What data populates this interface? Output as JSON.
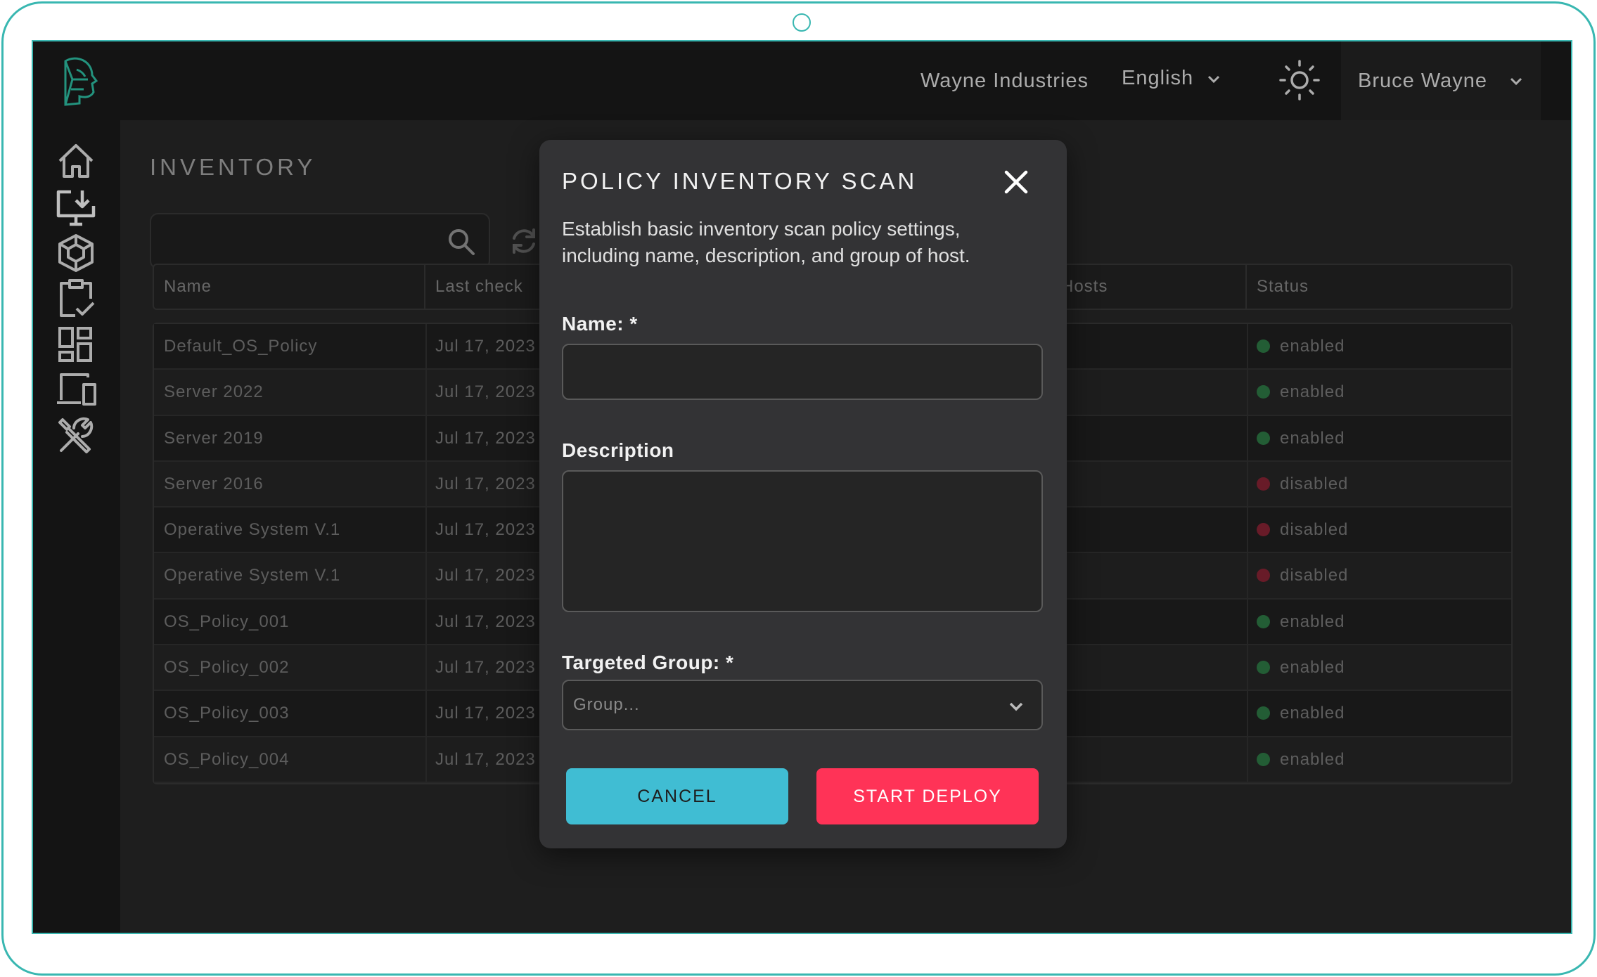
{
  "header": {
    "organization": "Wayne Industries",
    "language": "English",
    "user_name": "Bruce Wayne"
  },
  "sidebar": {
    "items": [
      {
        "icon": "home-icon"
      },
      {
        "icon": "download-monitor-icon"
      },
      {
        "icon": "cube-icon"
      },
      {
        "icon": "clipboard-check-icon"
      },
      {
        "icon": "dashboard-icon"
      },
      {
        "icon": "devices-icon"
      },
      {
        "icon": "tools-icon"
      }
    ]
  },
  "page": {
    "title": "INVENTORY",
    "search_placeholder": ""
  },
  "table": {
    "columns": [
      "Name",
      "Last check",
      "Hosts",
      "Status"
    ],
    "rows": [
      {
        "name": "Default_OS_Policy",
        "last_check": "Jul 17, 2023",
        "status": "enabled"
      },
      {
        "name": "Server 2022",
        "last_check": "Jul 17, 2023",
        "status": "enabled"
      },
      {
        "name": "Server 2019",
        "last_check": "Jul 17, 2023",
        "status": "enabled"
      },
      {
        "name": "Server 2016",
        "last_check": "Jul 17, 2023",
        "status": "disabled"
      },
      {
        "name": "Operative System V.1",
        "last_check": "Jul 17, 2023",
        "status": "disabled"
      },
      {
        "name": "Operative System V.1",
        "last_check": "Jul 17, 2023",
        "status": "disabled"
      },
      {
        "name": "OS_Policy_001",
        "last_check": "Jul 17, 2023",
        "status": "enabled"
      },
      {
        "name": "OS_Policy_002",
        "last_check": "Jul 17, 2023",
        "status": "enabled"
      },
      {
        "name": "OS_Policy_003",
        "last_check": "Jul 17, 2023",
        "status": "enabled"
      },
      {
        "name": "OS_Policy_004",
        "last_check": "Jul 17, 2023",
        "status": "enabled"
      }
    ],
    "status_colors": {
      "enabled": "#2f7d47",
      "disabled": "#8b2436"
    }
  },
  "modal": {
    "title": "POLICY INVENTORY SCAN",
    "description": "Establish basic inventory scan policy settings, including name, description, and group of host.",
    "name_label": "Name: *",
    "name_value": "",
    "description_label": "Description",
    "description_value": "",
    "group_label": "Targeted Group: *",
    "group_placeholder": "Group...",
    "cancel_label": "CANCEL",
    "deploy_label": "START DEPLOY"
  },
  "colors": {
    "accent_teal": "#39b7b1",
    "cancel_button": "#40bdd3",
    "deploy_button": "#ff3357"
  }
}
